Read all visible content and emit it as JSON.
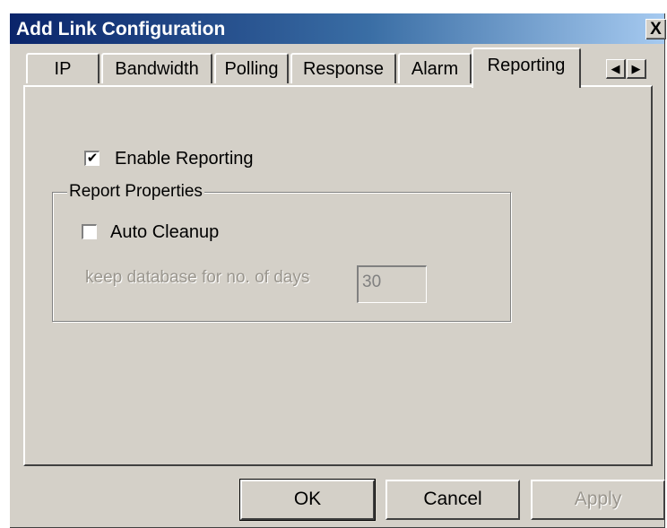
{
  "window": {
    "title": "Add Link Configuration",
    "close_symbol": "X"
  },
  "tabs": [
    {
      "label": "IP",
      "active": false
    },
    {
      "label": "Bandwidth",
      "active": false
    },
    {
      "label": "Polling",
      "active": false
    },
    {
      "label": "Response",
      "active": false
    },
    {
      "label": "Alarm",
      "active": false
    },
    {
      "label": "Reporting",
      "active": true
    }
  ],
  "tab_scroll": {
    "left": "◀",
    "right": "▶"
  },
  "reporting": {
    "enable_label": "Enable Reporting",
    "enable_checked": true,
    "check_mark": "✔",
    "group_label": "Report Properties",
    "auto_cleanup_label": "Auto Cleanup",
    "auto_cleanup_checked": false,
    "keep_days_label": "keep database for no. of days",
    "keep_days_value": "30"
  },
  "buttons": {
    "ok": "OK",
    "cancel": "Cancel",
    "apply": "Apply"
  }
}
